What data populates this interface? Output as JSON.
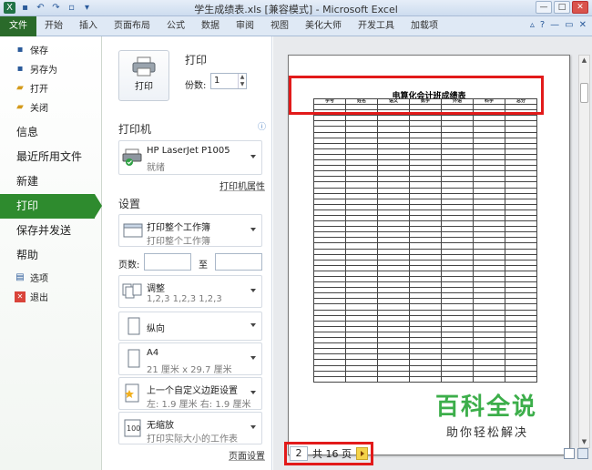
{
  "window": {
    "title": "学生成绩表.xls [兼容模式] - Microsoft Excel"
  },
  "ribbon": {
    "tabs": [
      "文件",
      "开始",
      "插入",
      "页面布局",
      "公式",
      "数据",
      "审阅",
      "视图",
      "美化大师",
      "开发工具",
      "加载项"
    ]
  },
  "backstage_nav": {
    "commands_top": [
      {
        "label": "保存",
        "icon": "save-icon"
      },
      {
        "label": "另存为",
        "icon": "save-as-icon"
      },
      {
        "label": "打开",
        "icon": "folder-open-icon"
      },
      {
        "label": "关闭",
        "icon": "folder-close-icon"
      }
    ],
    "items": [
      "信息",
      "最近所用文件",
      "新建",
      "打印",
      "保存并发送",
      "帮助"
    ],
    "active": "打印",
    "commands_bottom": [
      {
        "label": "选项",
        "icon": "options-icon"
      },
      {
        "label": "退出",
        "icon": "exit-icon"
      }
    ]
  },
  "print_panel": {
    "print_button": "打印",
    "heading": "打印",
    "copies_label": "份数:",
    "copies_value": "1",
    "printer_heading": "打印机",
    "printer_name": "HP LaserJet P1005",
    "printer_status": "就绪",
    "printer_properties_link": "打印机属性",
    "settings_heading": "设置",
    "scope_title": "打印整个工作簿",
    "scope_sub": "打印整个工作簿",
    "pages_label": "页数:",
    "pages_to_label": "至",
    "collate_title": "调整",
    "collate_sub": "1,2,3    1,2,3    1,2,3",
    "orientation": "纵向",
    "paper_title": "A4",
    "paper_sub": "21 厘米 x 29.7 厘米",
    "margins_title": "上一个自定义边距设置",
    "margins_sub": "左: 1.9 厘米    右: 1.9 厘米",
    "scaling_title": "无缩放",
    "scaling_sub": "打印实际大小的工作表",
    "page_setup_link": "页面设置"
  },
  "preview": {
    "doc_title": "电算化会计班成绩表",
    "columns": [
      "学号",
      "姓名",
      "语文",
      "数学",
      "外语",
      "科学",
      "总分"
    ],
    "current_page": "2",
    "total_pages_text": "共 16 页"
  },
  "watermark": {
    "brand": "百科全说",
    "slogan": "助你轻松解决"
  },
  "colors": {
    "accent_green": "#2e8b2e",
    "highlight_red": "#e21a1a",
    "watermark_green": "#3cae4a"
  }
}
